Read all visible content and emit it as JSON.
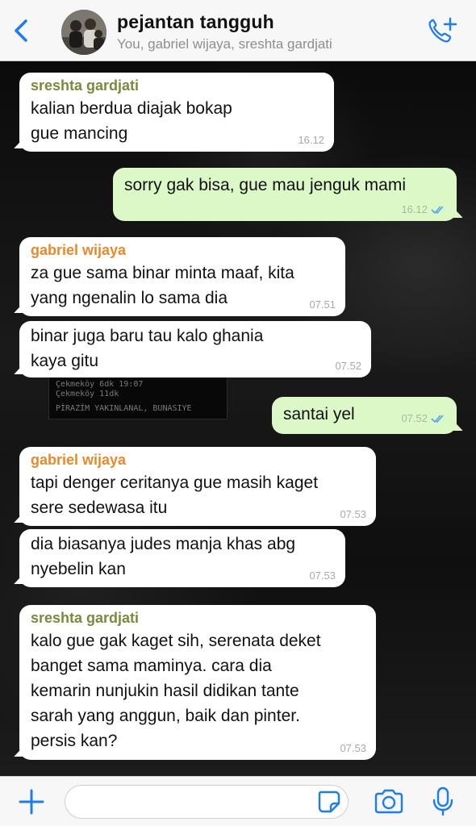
{
  "header": {
    "back_icon": "chevron-left-icon",
    "title": "pejantan tangguh",
    "subtitle": "You, gabriel wijaya, sreshta gardjati",
    "call_icon": "add-call-icon",
    "accent_color": "#1a7cf6"
  },
  "background_sign": {
    "line1": "Çekmeköy        6dk   19:07",
    "line2": "Çekmeköy        11dk",
    "line3": "PİRAZİM YAKINLANAL, BUNASIYE"
  },
  "messages": [
    {
      "direction": "in",
      "sender": "sreshta gardjati",
      "sender_color": "#7a8a3c",
      "lines": [
        "kalian berdua diajak bokap",
        "gue mancing"
      ],
      "time": "16.12"
    },
    {
      "direction": "out",
      "lines": [
        "sorry gak bisa, gue mau jenguk mami"
      ],
      "time": "16.12",
      "status": "read-double-check-icon"
    },
    {
      "direction": "in",
      "sender": "gabriel wijaya",
      "sender_color": "#e88a2a",
      "lines": [
        "za gue sama binar minta maaf, kita",
        "yang ngenalin lo sama dia"
      ],
      "time": "07.51"
    },
    {
      "direction": "in",
      "lines": [
        "binar juga baru tau kalo ghania",
        "kaya gitu"
      ],
      "time": "07.52"
    },
    {
      "direction": "out",
      "lines": [
        "santai yel"
      ],
      "time": "07.52",
      "status": "read-double-check-icon"
    },
    {
      "direction": "in",
      "sender": "gabriel wijaya",
      "sender_color": "#e88a2a",
      "lines": [
        "tapi denger ceritanya gue masih kaget",
        "sere sedewasa itu"
      ],
      "time": "07.53"
    },
    {
      "direction": "in",
      "lines": [
        "dia biasanya judes manja khas abg",
        "nyebelin kan"
      ],
      "time": "07.53"
    },
    {
      "direction": "in",
      "sender": "sreshta gardjati",
      "sender_color": "#7a8a3c",
      "lines": [
        "kalo gue gak kaget sih, serenata deket",
        "banget sama maminya. cara dia",
        "kemarin nunjukin hasil didikan tante",
        "sarah yang anggun, baik dan pinter.",
        "persis kan?"
      ],
      "time": "07.53"
    }
  ],
  "footer": {
    "plus_icon": "plus-icon",
    "input_value": "",
    "sticker_icon": "sticker-icon",
    "camera_icon": "camera-icon",
    "mic_icon": "microphone-icon"
  }
}
